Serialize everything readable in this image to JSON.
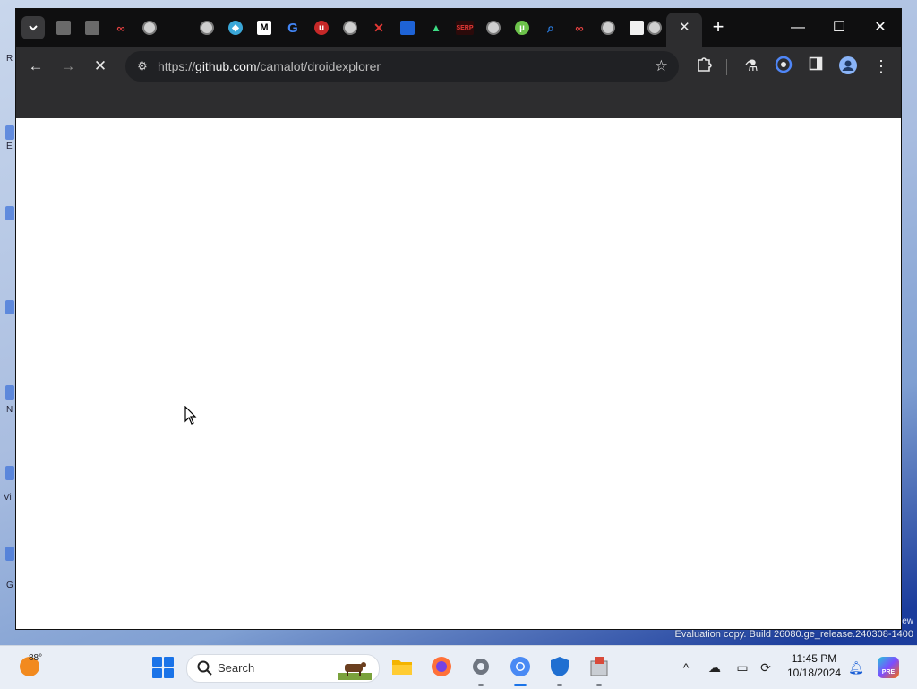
{
  "desktop": {
    "left_fragments": [
      "R",
      "E",
      "N",
      "Vi",
      "G"
    ]
  },
  "browser": {
    "tabs_menu_icon": "chevron-down-icon",
    "tab_favicons": [
      "notes-icon",
      "notes-icon",
      "infinity-icon",
      "globe-icon",
      "blank-icon",
      "globe-icon",
      "cube-icon",
      "medium-icon",
      "google-icon",
      "ublock-icon",
      "globe-icon",
      "x-icon",
      "docs-icon",
      "android-icon",
      "serp-icon",
      "globe-icon",
      "utorrent-icon",
      "search-icon",
      "infinity-icon",
      "globe-icon",
      "image-icon",
      "globe-icon"
    ],
    "active_tab_close": "✕",
    "new_tab": "+",
    "window_controls": {
      "minimize": "—",
      "maximize": "☐",
      "close": "✕"
    },
    "toolbar": {
      "back": "←",
      "forward": "→",
      "stop": "✕",
      "url_scheme": "https://",
      "url_host": "github.com",
      "url_path": "/camalot/droidexplorer",
      "bookmark_icon": "star-icon"
    },
    "extensions_icons": [
      "puzzle-icon",
      "flask-icon",
      "gemini-icon",
      "sidepanel-icon",
      "profile-icon",
      "menu-icon"
    ]
  },
  "watermark": {
    "line_top": "ew",
    "line": "Evaluation copy. Build 26080.ge_release.240308-1400"
  },
  "taskbar": {
    "weather_temp": "88°",
    "search_label": "Search",
    "pinned": [
      "file-explorer-icon",
      "firefox-icon",
      "settings-icon",
      "chrome-icon",
      "defender-icon",
      "installer-icon"
    ],
    "tray": [
      "chevron-up-icon",
      "cloud-off-icon",
      "display-icon",
      "sync-icon"
    ],
    "time": "11:45 PM",
    "date": "10/18/2024",
    "notification_icon": "bell-icon",
    "copilot_badge": "PRE"
  }
}
